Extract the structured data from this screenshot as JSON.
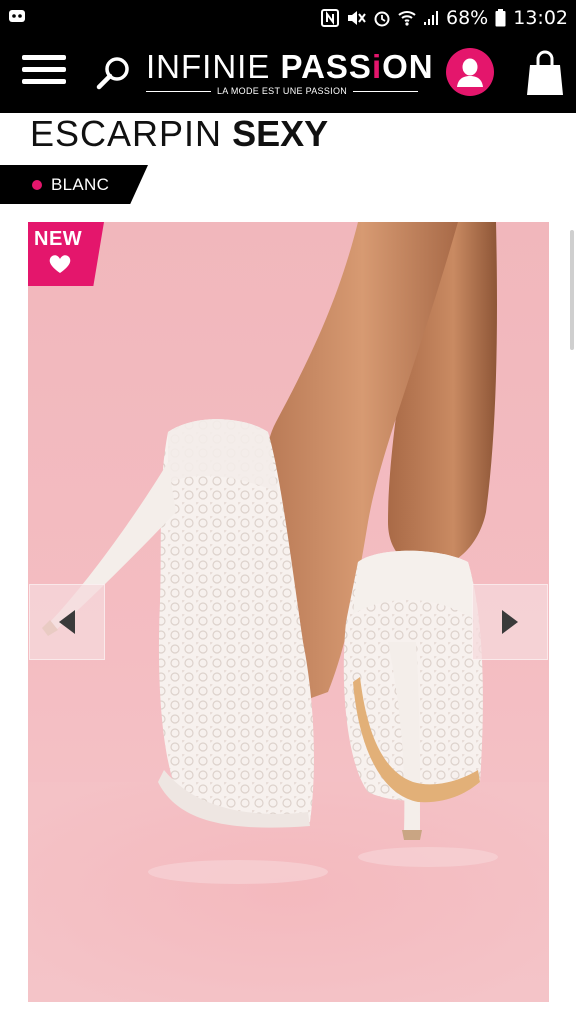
{
  "status_bar": {
    "battery": "68%",
    "time": "13:02"
  },
  "header": {
    "logo_word1": "INFINIE",
    "logo_word2_a": "PASS",
    "logo_word2_i": "i",
    "logo_word2_b": "ON",
    "logo_tagline": "LA MODE EST UNE PASSION",
    "accent_color": "#e4166c"
  },
  "product": {
    "title_light": "ESCARPIN",
    "title_bold": "SEXY",
    "color_label": "BLANC",
    "new_label": "NEW"
  },
  "icons": {
    "menu": "hamburger-icon",
    "search": "search-icon",
    "account": "user-icon",
    "cart": "shopping-bag-icon",
    "prev": "arrow-left-icon",
    "next": "arrow-right-icon"
  }
}
